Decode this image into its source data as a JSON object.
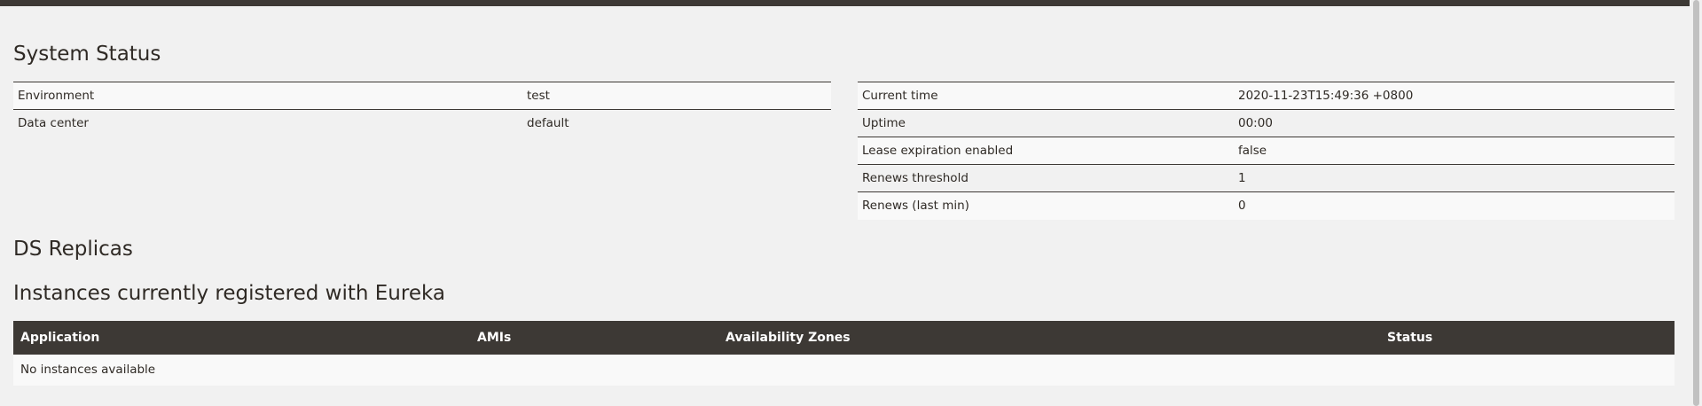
{
  "system_status": {
    "title": "System Status",
    "left_table": [
      {
        "key": "Environment",
        "value": "test"
      },
      {
        "key": "Data center",
        "value": "default"
      }
    ],
    "right_table": [
      {
        "key": "Current time",
        "value": "2020-11-23T15:49:36 +0800"
      },
      {
        "key": "Uptime",
        "value": "00:00"
      },
      {
        "key": "Lease expiration enabled",
        "value": "false"
      },
      {
        "key": "Renews threshold",
        "value": "1"
      },
      {
        "key": "Renews (last min)",
        "value": "0"
      }
    ]
  },
  "ds_replicas": {
    "title": "DS Replicas"
  },
  "instances": {
    "title": "Instances currently registered with Eureka",
    "columns": [
      "Application",
      "AMIs",
      "Availability Zones",
      "Status"
    ],
    "empty_message": "No instances available"
  },
  "colors": {
    "header_bg": "#3d3935",
    "page_bg": "#f1f1f1",
    "row_alt_bg": "#f9f9f9"
  }
}
